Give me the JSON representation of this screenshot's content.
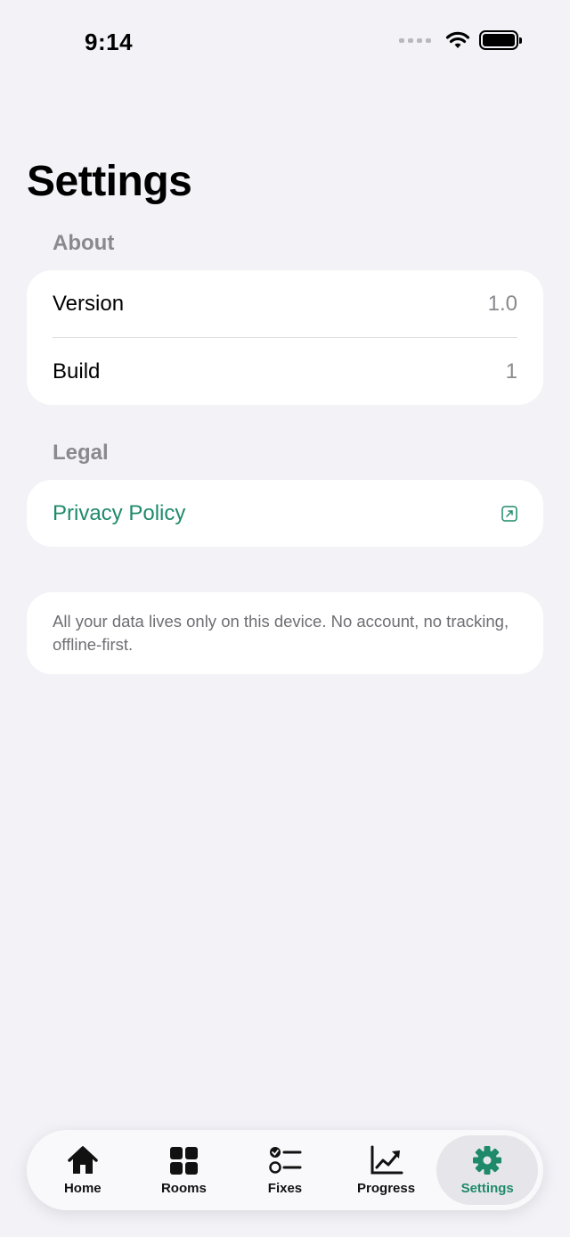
{
  "status_bar": {
    "time": "9:14"
  },
  "page": {
    "title": "Settings"
  },
  "about": {
    "header": "About",
    "rows": [
      {
        "label": "Version",
        "value": "1.0"
      },
      {
        "label": "Build",
        "value": "1"
      }
    ]
  },
  "legal": {
    "header": "Legal",
    "privacy_label": "Privacy Policy"
  },
  "info": {
    "text": "All your data lives only on this device. No account, no tracking, offline-first."
  },
  "tabbar": {
    "tabs": [
      {
        "label": "Home",
        "icon": "house-icon"
      },
      {
        "label": "Rooms",
        "icon": "grid-icon"
      },
      {
        "label": "Fixes",
        "icon": "checklist-icon"
      },
      {
        "label": "Progress",
        "icon": "chart-icon"
      },
      {
        "label": "Settings",
        "icon": "gear-icon",
        "active": true
      }
    ]
  },
  "colors": {
    "accent": "#1f8a6a",
    "background": "#f2f2f7",
    "secondary_text": "#8a8a8e"
  }
}
